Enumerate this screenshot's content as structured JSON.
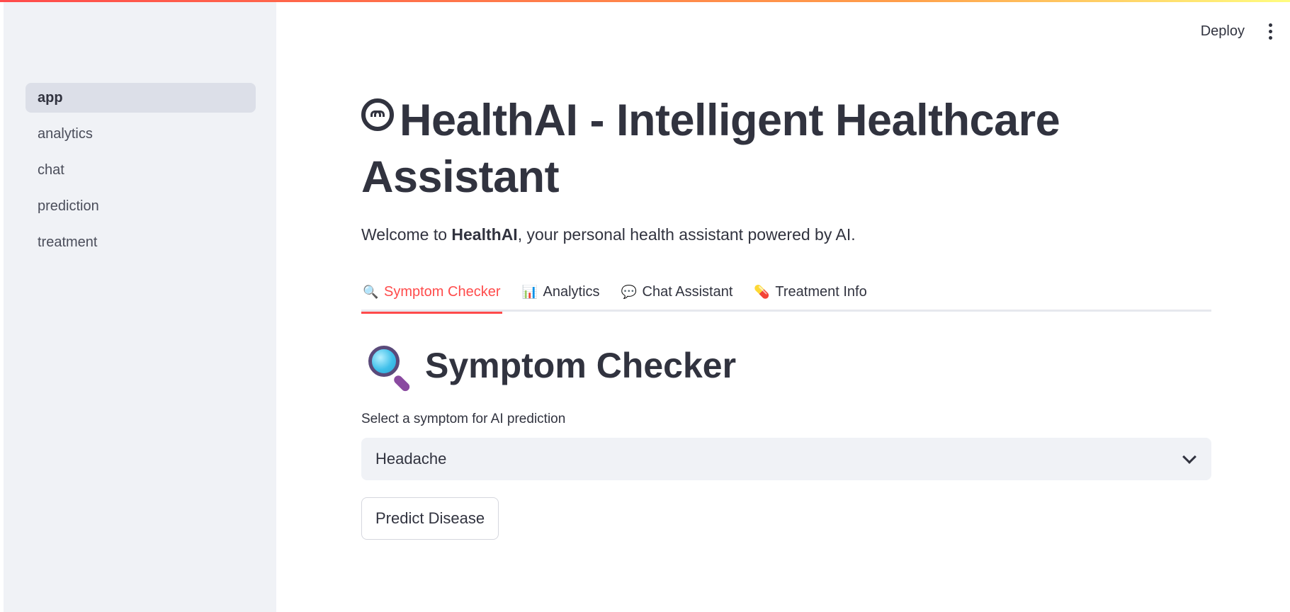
{
  "header": {
    "deploy_label": "Deploy"
  },
  "sidebar": {
    "items": [
      {
        "label": "app",
        "active": true
      },
      {
        "label": "analytics"
      },
      {
        "label": "chat"
      },
      {
        "label": "prediction"
      },
      {
        "label": "treatment"
      }
    ]
  },
  "main": {
    "title": "HealthAI - Intelligent Healthcare Assistant",
    "subtitle_prefix": "Welcome to ",
    "subtitle_bold": "HealthAI",
    "subtitle_suffix": ", your personal health assistant powered by AI.",
    "tabs": [
      {
        "icon": "🔍",
        "icon_name": "magnifier-icon",
        "label": "Symptom Checker",
        "active": true
      },
      {
        "icon": "📊",
        "icon_name": "bar-chart-icon",
        "label": "Analytics"
      },
      {
        "icon": "💬",
        "icon_name": "speech-bubble-icon",
        "label": "Chat Assistant"
      },
      {
        "icon": "💊",
        "icon_name": "pill-icon",
        "label": "Treatment Info"
      }
    ],
    "section_title": "Symptom Checker",
    "select_label": "Select a symptom for AI prediction",
    "select_value": "Headache",
    "predict_button": "Predict Disease"
  },
  "colors": {
    "accent": "#ff4b4b",
    "text": "#31333f",
    "sidebar_bg": "#f0f2f6"
  }
}
